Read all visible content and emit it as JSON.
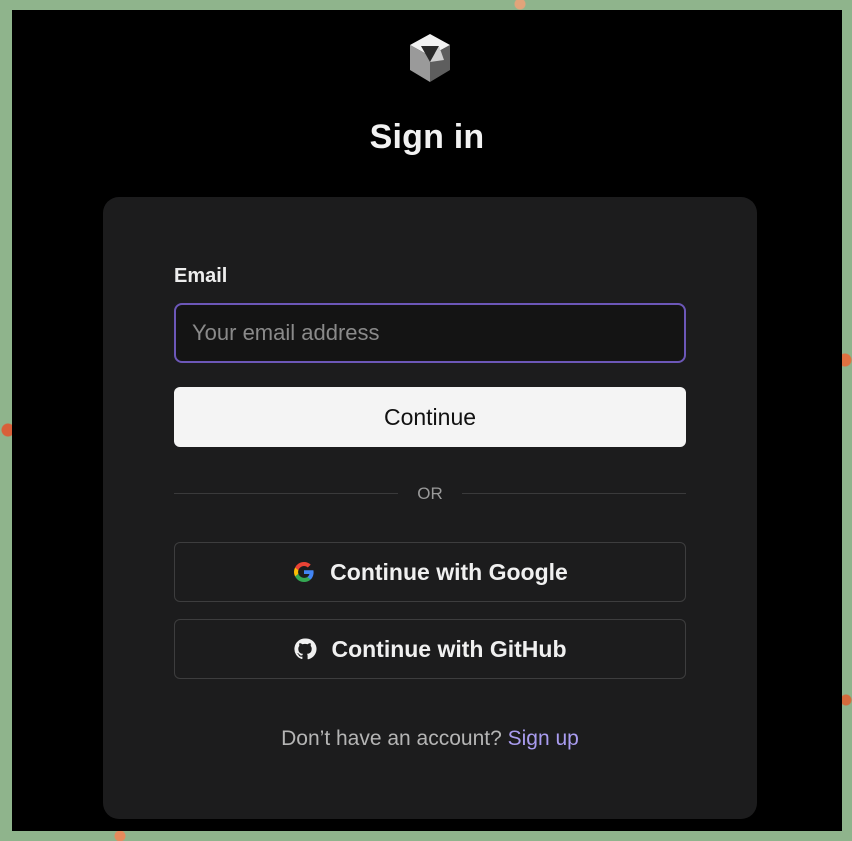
{
  "page": {
    "title": "Sign in"
  },
  "form": {
    "email_label": "Email",
    "email_placeholder": "Your email address",
    "email_value": "",
    "continue_label": "Continue",
    "divider_text": "OR"
  },
  "oauth": {
    "google_label": "Continue with Google",
    "github_label": "Continue with GitHub"
  },
  "footer": {
    "prompt": "Don’t have an account?",
    "signup_label": "Sign up"
  },
  "icons": {
    "logo": "cube-logo-icon",
    "google": "google-icon",
    "github": "github-icon"
  },
  "colors": {
    "background": "#000000",
    "card": "#1c1c1d",
    "input_focus_border": "#6c57b8",
    "primary_button": "#f4f4f4",
    "link": "#a99cf0"
  }
}
